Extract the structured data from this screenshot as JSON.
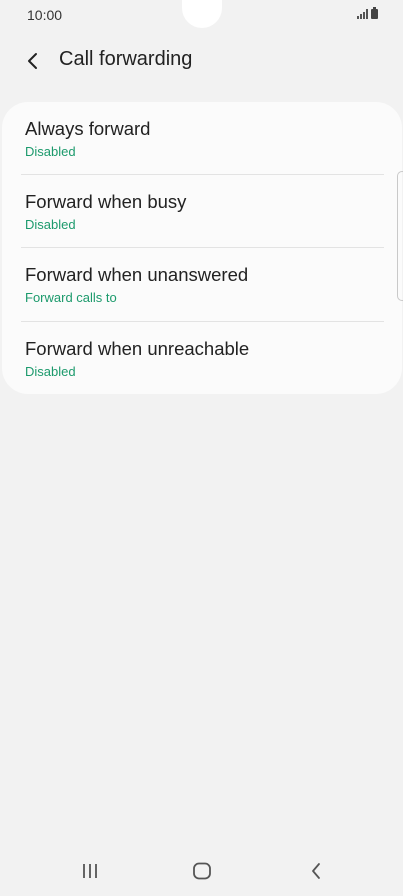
{
  "status_bar": {
    "time": "10:00"
  },
  "header": {
    "title": "Call forwarding",
    "back_icon": "chevron-left-icon"
  },
  "forwarding_options": [
    {
      "title": "Always forward",
      "status": "Disabled"
    },
    {
      "title": "Forward when busy",
      "status": "Disabled"
    },
    {
      "title": "Forward when unanswered",
      "status": "Forward calls to"
    },
    {
      "title": "Forward when unreachable",
      "status": "Disabled"
    }
  ],
  "nav_bar": {
    "recents_icon": "recent-apps-icon",
    "home_icon": "home-icon",
    "back_icon": "back-icon"
  },
  "colors": {
    "background": "#f2f2f2",
    "card": "#fbfbfb",
    "status_green": "#1c9a6c",
    "text": "#222222"
  }
}
